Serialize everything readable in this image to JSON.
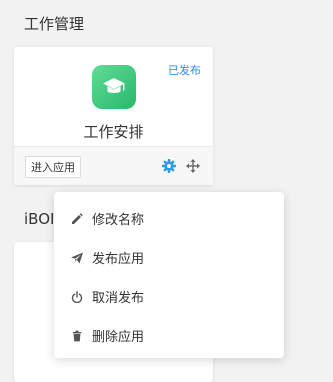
{
  "sections": {
    "work_management": "工作管理",
    "ibot_partial": "iBOI"
  },
  "app_card": {
    "status": "已发布",
    "icon": "graduation-cap-icon",
    "name": "工作安排",
    "enter_button": "进入应用",
    "settings_icon": "gear-icon",
    "move_icon": "move-arrows-icon"
  },
  "context_menu": {
    "items": [
      {
        "label": "修改名称",
        "icon": "pencil-icon"
      },
      {
        "label": "发布应用",
        "icon": "paper-plane-icon"
      },
      {
        "label": "取消发布",
        "icon": "power-icon"
      },
      {
        "label": "删除应用",
        "icon": "trash-icon"
      }
    ]
  },
  "colors": {
    "accent_blue": "#2f8be6",
    "app_icon_green": "#3cc97e"
  }
}
